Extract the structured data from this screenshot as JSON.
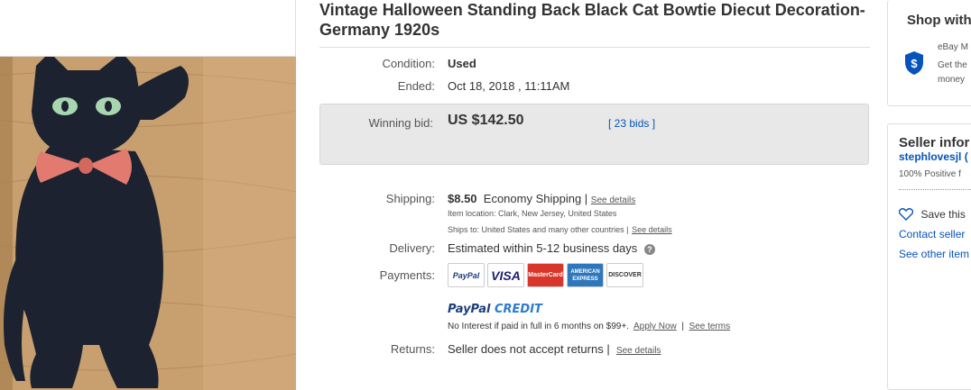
{
  "listing": {
    "title": "Vintage Halloween Standing Back Black Cat Bowtie Diecut Decoration- Germany 1920s",
    "condition_label": "Condition:",
    "condition_value": "Used",
    "ended_label": "Ended:",
    "ended_value": "Oct 18, 2018 , 11:11AM",
    "winning_bid_label": "Winning bid:",
    "winning_bid_value": "US $142.50",
    "bids_link": "[ 23 bids ]"
  },
  "shipping": {
    "label": "Shipping:",
    "price": "$8.50",
    "method": "Economy Shipping |",
    "see_details": "See details",
    "item_location": "Item location:  Clark, New Jersey, United States",
    "ships_to": "Ships to:  United States and many other countries |",
    "ships_see_details": "See details"
  },
  "delivery": {
    "label": "Delivery:",
    "value": "Estimated within 5-12 business days",
    "help_icon": "?"
  },
  "payments": {
    "label": "Payments:",
    "logos": [
      "PayPal",
      "VISA",
      "MasterCard",
      "AMERICAN EXPRESS",
      "DISCOVER"
    ],
    "paypal_credit": "PayPal CREDIT",
    "pp_credit_paypal": "PayPal",
    "pp_credit_word": "CREDIT",
    "credit_text": "No Interest if paid in full in 6 months on $99+.",
    "apply_now": "Apply Now",
    "divider": "|",
    "see_terms": "See terms"
  },
  "returns": {
    "label": "Returns:",
    "value": "Seller does not accept returns |",
    "see_details": "See details"
  },
  "sidebar": {
    "shop_title": "Shop with",
    "ebay_m": "eBay M",
    "get_the": "Get the",
    "money": "money",
    "seller_title": "Seller infor",
    "seller_name": "stephlovesjl (",
    "positive": "100% Positive f",
    "save_this": "Save this",
    "contact": "Contact seller",
    "see_other": "See other item"
  },
  "colors": {
    "link_blue": "#0654ba",
    "bid_box_bg": "#e8e8e8",
    "shield_blue": "#0654ba"
  }
}
